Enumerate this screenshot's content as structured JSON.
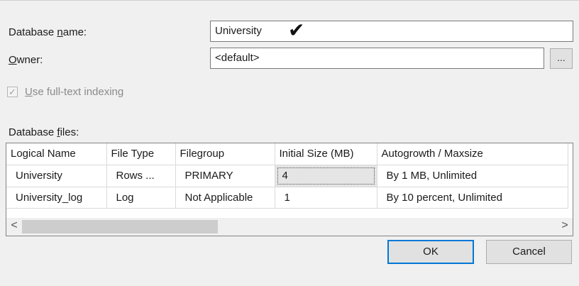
{
  "form": {
    "db_name_prefix": "Database ",
    "db_name_accel": "n",
    "db_name_suffix": "ame:",
    "db_name_value": "University",
    "owner_accel": "O",
    "owner_suffix": "wner:",
    "owner_value": "<default>",
    "browse_label": "...",
    "fulltext_accel": "U",
    "fulltext_suffix": "se full-text indexing",
    "fulltext_checked": true,
    "files_prefix": "Database ",
    "files_accel": "f",
    "files_suffix": "iles:"
  },
  "annotation": {
    "check_glyph": "✔"
  },
  "grid": {
    "columns": [
      "Logical Name",
      "File Type",
      "Filegroup",
      "Initial Size (MB)",
      "Autogrowth / Maxsize"
    ],
    "rows": [
      [
        "University",
        "Rows ...",
        "PRIMARY",
        "4",
        "By 1 MB, Unlimited"
      ],
      [
        "University_log",
        "Log",
        "Not Applicable",
        "1",
        "By 10 percent, Unlimited"
      ]
    ],
    "scroll_left_glyph": "<",
    "scroll_right_glyph": ">"
  },
  "buttons": {
    "ok": "OK",
    "cancel": "Cancel"
  },
  "colors": {
    "focus_border": "#0078d7",
    "background": "#f0f0f0"
  }
}
